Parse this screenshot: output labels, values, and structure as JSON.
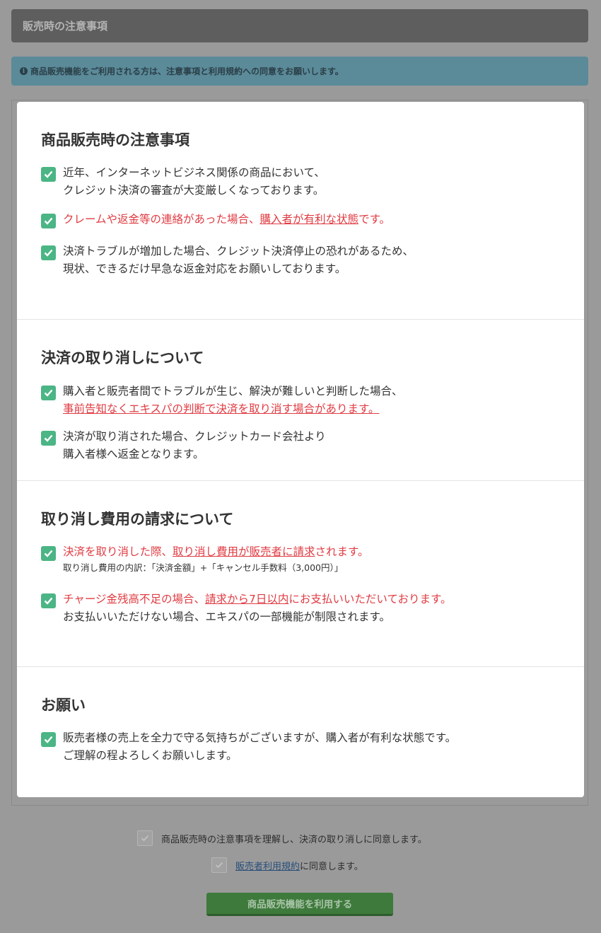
{
  "header": {
    "title": "販売時の注意事項"
  },
  "info": {
    "icon": "info-circle-icon",
    "text": "商品販売機能をご利用される方は、注意事項と利用規約への同意をお願いします。"
  },
  "sections": [
    {
      "title": "商品販売時の注意事項",
      "items": [
        {
          "line1": "近年、インターネットビジネス関係の商品において、",
          "line2": "クレジット決済の審査が大変厳しくなっております。"
        },
        {
          "a": "クレームや返金等の連絡があった場合、",
          "b": "購入者が有利な状態",
          "c": "です。"
        },
        {
          "line1": "決済トラブルが増加した場合、クレジット決済停止の恐れがあるため、",
          "line2": "現状、できるだけ早急な返金対応をお願いしております。"
        }
      ]
    },
    {
      "title": "決済の取り消しについて",
      "items": [
        {
          "line1": "購入者と販売者間でトラブルが生じ、解決が難しいと判断した場合、",
          "line2": "事前告知なくエキスパの判断で決済を取り消す場合があります。"
        },
        {
          "line1": "決済が取り消された場合、クレジットカード会社より",
          "line2": "購入者様へ返金となります。"
        }
      ]
    },
    {
      "title": "取り消し費用の請求について",
      "items": [
        {
          "a": "決済を取り消した際、",
          "b": "取り消し費用が販売者に請求",
          "c": "されます。",
          "note": "取り消し費用の内訳：「決済金額」+「キャンセル手数料（3,000円）」"
        },
        {
          "a": "チャージ金残高不足の場合、",
          "b": "請求から7日以内",
          "c": "にお支払いいただいております。",
          "line2": "お支払いいただけない場合、エキスパの一部機能が制限されます。"
        }
      ]
    },
    {
      "title": "お願い",
      "items": [
        {
          "line1": "販売者様の売上を全力で守る気持ちがございますが、購入者が有利な状態です。",
          "line2": "ご理解の程よろしくお願いします。"
        }
      ]
    }
  ],
  "agreements": {
    "agree1": "商品販売時の注意事項を理解し、決済の取り消しに同意します。",
    "agree2_link": "販売者利用規約",
    "agree2_rest": "に同意します。"
  },
  "submit": {
    "label": "商品販売機能を利用する"
  },
  "colors": {
    "check": "#4bb585",
    "alert_red": "#e03c43",
    "button": "#3e7a3c",
    "info_bar": "#5b8a99"
  }
}
